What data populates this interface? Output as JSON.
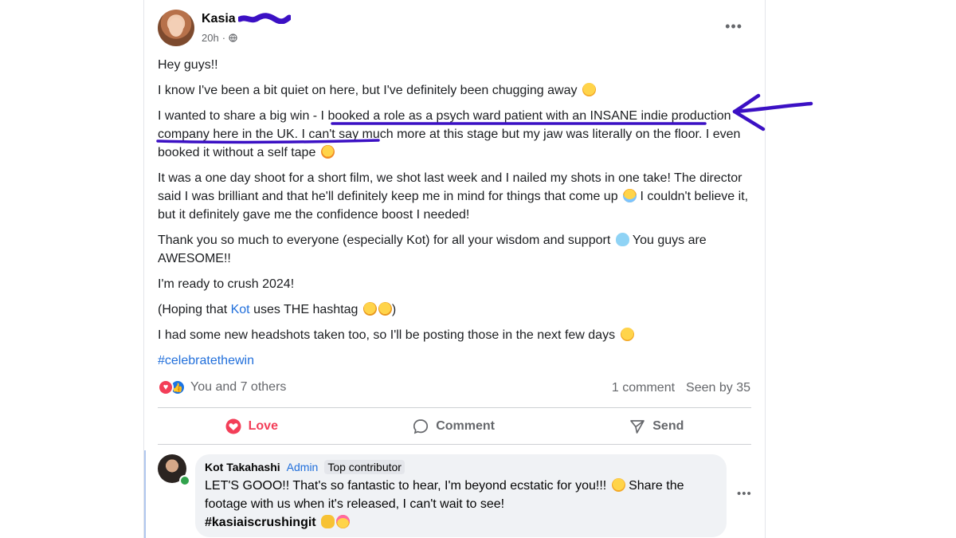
{
  "post": {
    "author_name": "Kasia",
    "time": "20h",
    "privacy_icon": "globe-icon",
    "paragraphs": {
      "p1": "Hey guys!!",
      "p2": "I know I've been a bit quiet on here, but I've definitely been chugging away",
      "p3_a": "I wanted to share a big win - I booked a role as a psych ward patient with an INSANE indie production company here in the UK. I can't say much more at this stage but my jaw was literally on the floor. I even booked it without a self tape",
      "p4": "It was a one day shoot for a short film, we shot last week and I nailed my shots in one take! The director said I was brilliant and that he'll definitely keep me in mind for things that come up",
      "p4_b": "I couldn't believe it, but it definitely gave me the confidence boost I needed!",
      "p5": "Thank you so much to everyone (especially Kot) for all your wisdom and support",
      "p5_b": "You guys are AWESOME!!",
      "p6": "I'm ready to crush 2024!",
      "p7_a": "(Hoping that ",
      "p7_link": "Kot",
      "p7_b": " uses THE hashtag",
      "p7_c": ")",
      "p8": "I had some new headshots taken too, so I'll be posting those in the next few days",
      "hashtag": "#celebratethewin"
    },
    "reactions_text": "You and 7 others",
    "comments_count": "1 comment",
    "seen_by": "Seen by 35",
    "actions": {
      "love": "Love",
      "comment": "Comment",
      "send": "Send"
    }
  },
  "comment": {
    "author": "Kot Takahashi",
    "role": "Admin",
    "badge": "Top contributor",
    "text_a": "LET'S GOOO!! That's so fantastic to hear, I'm beyond ecstatic for you!!!",
    "text_b": "Share the footage with us when it's released, I can't wait to see!",
    "hashtag": "#kasiaiscrushingit"
  },
  "colors": {
    "accent": "#216fdb",
    "love": "#f33e58",
    "annotation": "#3b10c4"
  }
}
